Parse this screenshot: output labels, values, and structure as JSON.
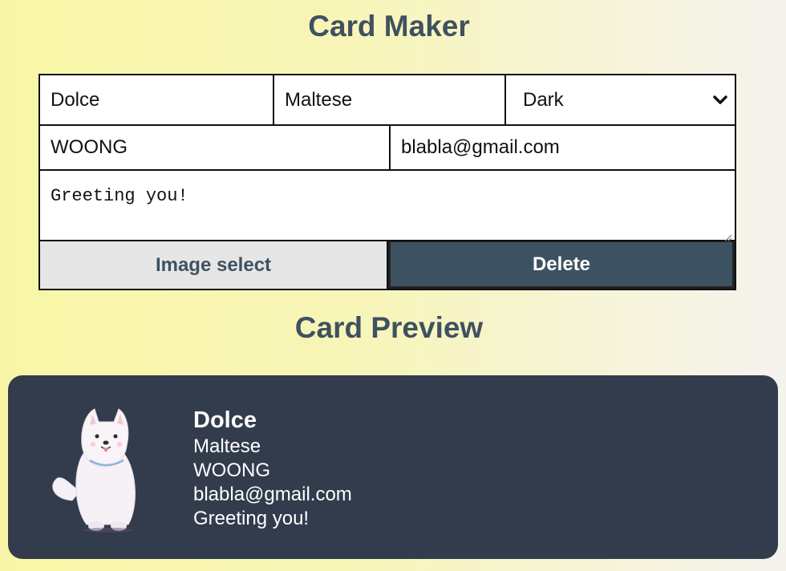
{
  "maker": {
    "title": "Card Maker",
    "name_value": "Dolce",
    "company_value": "Maltese",
    "theme_selected": "Dark",
    "title_value": "WOONG",
    "email_value": "blabla@gmail.com",
    "message_value": "Greeting you!",
    "image_button": "Image select",
    "delete_button": "Delete"
  },
  "preview": {
    "title": "Card Preview",
    "card": {
      "name": "Dolce",
      "company": "Maltese",
      "title": "WOONG",
      "email": "blabla@gmail.com",
      "message": "Greeting you!",
      "avatar_icon": "samoyed-dog-avatar",
      "theme_colors": {
        "background": "#323c4d",
        "text": "#ffffff"
      }
    }
  },
  "colors": {
    "accent": "#3f5160",
    "delete_bg": "#3d5260",
    "image_button_bg": "#e7e6e6"
  }
}
